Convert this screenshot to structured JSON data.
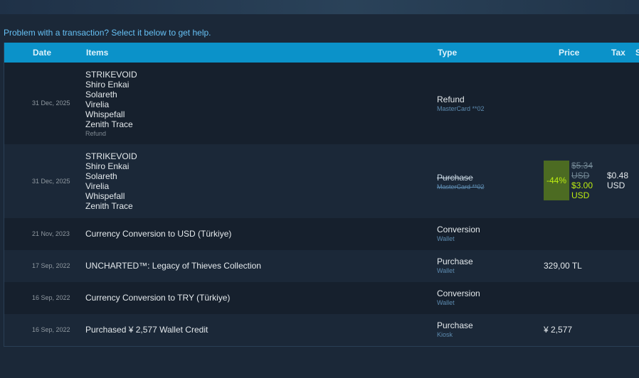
{
  "help_text": "Problem with a transaction? Select it below to get help.",
  "table": {
    "headers": {
      "date": "Date",
      "items": "Items",
      "type": "Type",
      "price": "Price",
      "tax": "Tax",
      "status_partial": "S"
    },
    "rows": [
      {
        "date": "31 Dec, 2025",
        "items": [
          "STRIKEVOID",
          "Shiro Enkai",
          "Solareth",
          "Virelia",
          "Whispefall",
          "Zenith Trace"
        ],
        "items_sub": "Refund",
        "type": "Refund",
        "type_sub": "MasterCard **02"
      },
      {
        "date": "31 Dec, 2025",
        "items": [
          "STRIKEVOID",
          "Shiro Enkai",
          "Solareth",
          "Virelia",
          "Whispefall",
          "Zenith Trace"
        ],
        "type": "Purchase",
        "type_sub": "MasterCard **02",
        "discount": "-44%",
        "orig_price_1": "$5.34",
        "orig_price_2": "USD",
        "final_price_1": "$3.00",
        "final_price_2": "USD",
        "tax_1": "$0.48",
        "tax_2": "USD"
      },
      {
        "date": "21 Nov, 2023",
        "item": "Currency Conversion to USD (Türkiye)",
        "type": "Conversion",
        "type_sub": "Wallet"
      },
      {
        "date": "17 Sep, 2022",
        "item": "UNCHARTED™: Legacy of Thieves Collection",
        "type": "Purchase",
        "type_sub": "Wallet",
        "price": "329,00 TL"
      },
      {
        "date": "16 Sep, 2022",
        "item": "Currency Conversion to TRY (Türkiye)",
        "type": "Conversion",
        "type_sub": "Wallet"
      },
      {
        "date": "16 Sep, 2022",
        "item": "Purchased ¥ 2,577 Wallet Credit",
        "type": "Purchase",
        "type_sub": "Kiosk",
        "price": "¥ 2,577"
      }
    ]
  },
  "colors": {
    "header_bg": "#0b92c9",
    "discount_bg": "#4c6b22",
    "discount_text": "#beee11",
    "link": "#66c0f4"
  }
}
